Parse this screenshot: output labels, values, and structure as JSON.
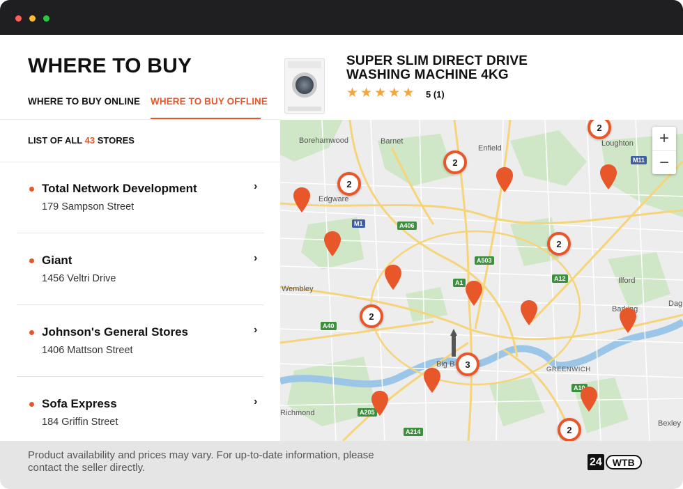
{
  "header": {
    "title": "WHERE TO BUY",
    "tabs": [
      {
        "label": "WHERE TO BUY ONLINE",
        "active": false
      },
      {
        "label": "WHERE TO BUY OFFLINE",
        "active": true
      }
    ]
  },
  "product": {
    "name": "SUPER SLIM DIRECT DRIVE WASHING MACHINE 4KG",
    "rating_text": "5 (1)",
    "stars": 5
  },
  "store_list": {
    "prefix": "LIST OF ALL",
    "count": "43",
    "suffix": "STORES",
    "stores": [
      {
        "name": "Total Network Development",
        "address": "179 Sampson Street"
      },
      {
        "name": "Giant",
        "address": "1456 Veltri Drive"
      },
      {
        "name": "Johnson's General Stores",
        "address": "1406 Mattson Street"
      },
      {
        "name": "Sofa Express",
        "address": "184 Griffin Street"
      }
    ]
  },
  "map": {
    "place_labels": [
      "Borehamwood",
      "Barnet",
      "Enfield",
      "Loughton",
      "Edgware",
      "Wembley",
      "Ilford",
      "Barking",
      "Dag",
      "Big B",
      "GREENWICH",
      "Richmond",
      "Bexley"
    ],
    "road_labels": [
      "M1",
      "A406",
      "A503",
      "A1",
      "A12",
      "A40",
      "A205",
      "A214",
      "A10",
      "M11"
    ],
    "clusters": [
      "2",
      "2",
      "2",
      "2",
      "2",
      "3",
      "2"
    ],
    "zoom_in": "+",
    "zoom_out": "−"
  },
  "footer": {
    "note": "Product availability and prices may vary. For up-to-date information, please contact the seller directly.",
    "logo_number": "24",
    "logo_text": "WTB"
  },
  "colors": {
    "accent": "#e8572a",
    "star": "#f5a63a",
    "titlebar": "#1f1f21"
  }
}
